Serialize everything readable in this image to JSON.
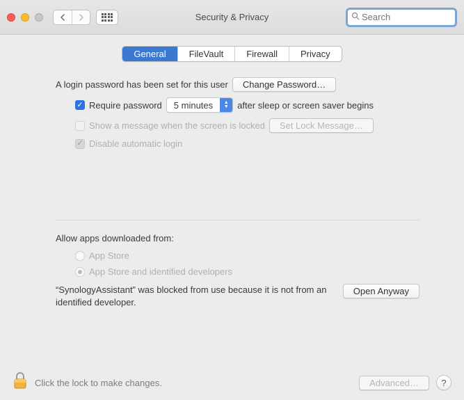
{
  "window": {
    "title": "Security & Privacy"
  },
  "search": {
    "placeholder": "Search"
  },
  "tabs": [
    {
      "label": "General",
      "active": true
    },
    {
      "label": "FileVault",
      "active": false
    },
    {
      "label": "Firewall",
      "active": false
    },
    {
      "label": "Privacy",
      "active": false
    }
  ],
  "general": {
    "login_password_text": "A login password has been set for this user",
    "change_password_btn": "Change Password…",
    "require_password_label": "Require password",
    "delay_value": "5 minutes",
    "after_sleep_text": "after sleep or screen saver begins",
    "show_message_label": "Show a message when the screen is locked",
    "set_lock_message_btn": "Set Lock Message…",
    "disable_auto_login_label": "Disable automatic login"
  },
  "gatekeeper": {
    "section_label": "Allow apps downloaded from:",
    "option_app_store": "App Store",
    "option_identified": "App Store and identified developers",
    "blocked_text": "“SynologyAssistant” was blocked from use because it is not from an identified developer.",
    "open_anyway_btn": "Open Anyway"
  },
  "footer": {
    "lock_text": "Click the lock to make changes.",
    "advanced_btn": "Advanced…",
    "help": "?"
  }
}
